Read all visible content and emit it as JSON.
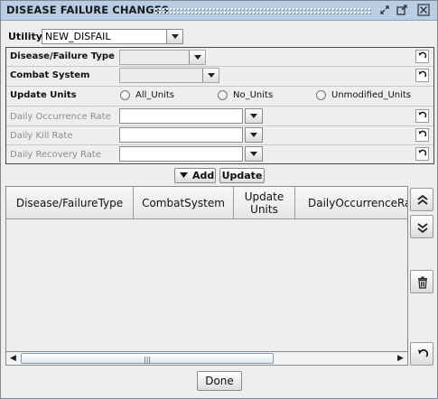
{
  "window": {
    "title": "DISEASE FAILURE CHANGES",
    "controls": [
      "restore-icon",
      "maximize-icon",
      "close-icon"
    ]
  },
  "utility": {
    "label": "Utility:",
    "value": "NEW_DISFAIL"
  },
  "fields": {
    "disease_failure_type": {
      "label": "Disease/Failure Type",
      "value": ""
    },
    "combat_system": {
      "label": "Combat System",
      "value": ""
    },
    "update_units": {
      "label": "Update Units",
      "options": [
        "All_Units",
        "No_Units",
        "Unmodified_Units"
      ],
      "selected": null
    },
    "daily_occurrence_rate": {
      "label": "Daily Occurrence Rate",
      "value": ""
    },
    "daily_kill_rate": {
      "label": "Daily Kill Rate",
      "value": ""
    },
    "daily_recovery_rate": {
      "label": "Daily Recovery Rate",
      "value": ""
    }
  },
  "actions": {
    "add_label": "Add",
    "update_label": "Update"
  },
  "table": {
    "columns": [
      "Disease/FailureType",
      "CombatSystem",
      "Update Units",
      "DailyOccurrenceRat"
    ],
    "rows": []
  },
  "side_buttons": [
    "move-up-icon",
    "move-down-icon",
    "trash-icon",
    "undo-icon"
  ],
  "footer": {
    "done_label": "Done"
  }
}
